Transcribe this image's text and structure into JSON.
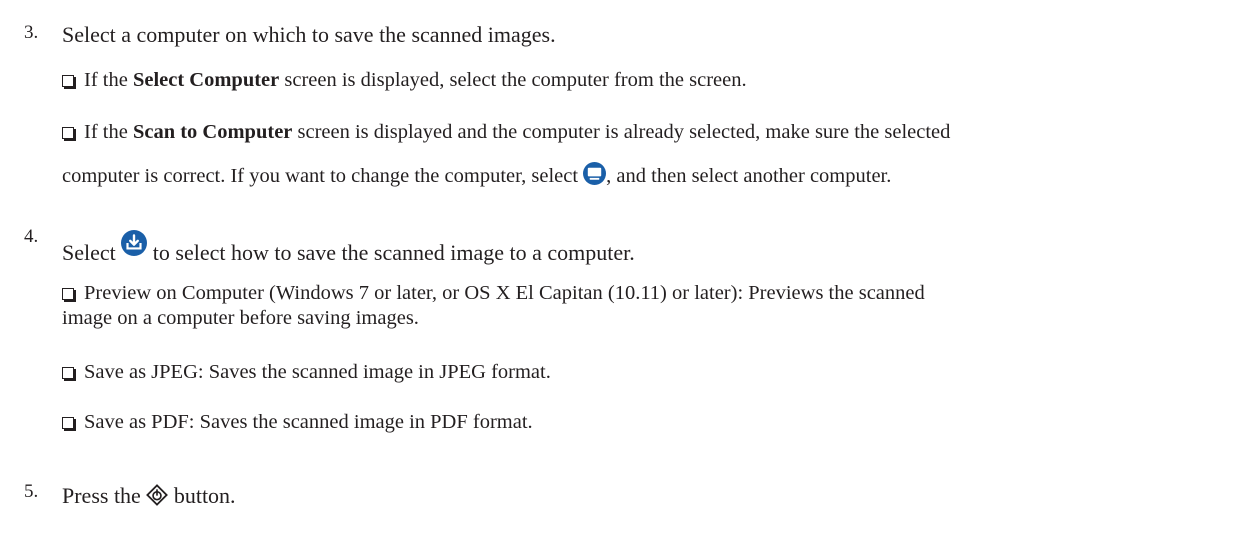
{
  "step3": {
    "number": "3.",
    "text": "Select a computer on which to save the scanned images.",
    "bullet1": {
      "pre": "If the ",
      "bold": "Select Computer",
      "post": " screen is displayed, select the computer from the screen."
    },
    "bullet2": {
      "pre": "If the ",
      "bold": "Scan to Computer",
      "post": " screen is displayed and the computer is already selected, make sure the selected",
      "line2_pre": "computer is correct. If you want to change the computer, select ",
      "icon": "computer-select-icon",
      "line2_post": ", and then select another computer."
    }
  },
  "step4": {
    "number": "4.",
    "pre": "Select ",
    "icon": "save-to-computer-icon",
    "post": " to select how to save the scanned image to a computer.",
    "bullets": [
      {
        "line1": "Preview on Computer (Windows 7 or later, or OS X El Capitan (10.11) or later): Previews the scanned",
        "line2": "image on a computer before saving images."
      },
      {
        "line1": "Save as JPEG: Saves the scanned image in JPEG format."
      },
      {
        "line1": "Save as PDF: Saves the scanned image in PDF format."
      }
    ]
  },
  "step5": {
    "number": "5.",
    "pre": "Press the ",
    "icon": "start-button-icon",
    "post": " button."
  },
  "colors": {
    "text": "#231f20",
    "icon_blue": "#1a5fa8"
  }
}
